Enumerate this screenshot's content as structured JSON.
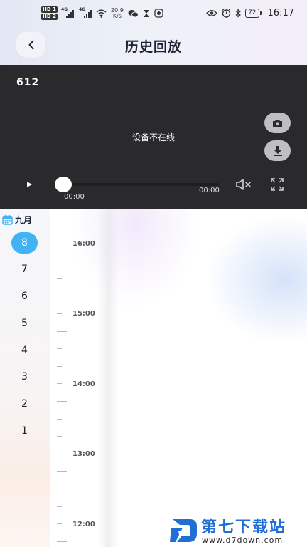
{
  "status_bar": {
    "hd1": "HD 1",
    "hd2": "HD 2",
    "signal1": "4G",
    "signal2": "4G",
    "net_speed_value": "20.9",
    "net_speed_unit": "K/s",
    "battery": "72",
    "time": "16:17"
  },
  "header": {
    "title": "历史回放"
  },
  "player": {
    "device_id": "612",
    "status_text": "设备不在线",
    "current_time": "00:00",
    "total_time": "00:00",
    "progress": 0
  },
  "calendar": {
    "month": "九月",
    "days": [
      "8",
      "7",
      "6",
      "5",
      "4",
      "3",
      "2",
      "1"
    ],
    "selected_day": "8"
  },
  "timeline": {
    "labels": [
      "16:00",
      "15:00",
      "14:00",
      "13:00",
      "12:00"
    ]
  },
  "watermark": {
    "brand": "第七下载站",
    "url": "www.d7down.com"
  },
  "colors": {
    "accent": "#3fb3f4",
    "player_bg": "#2a2a2c",
    "watermark_blue": "#1f6fd6"
  }
}
